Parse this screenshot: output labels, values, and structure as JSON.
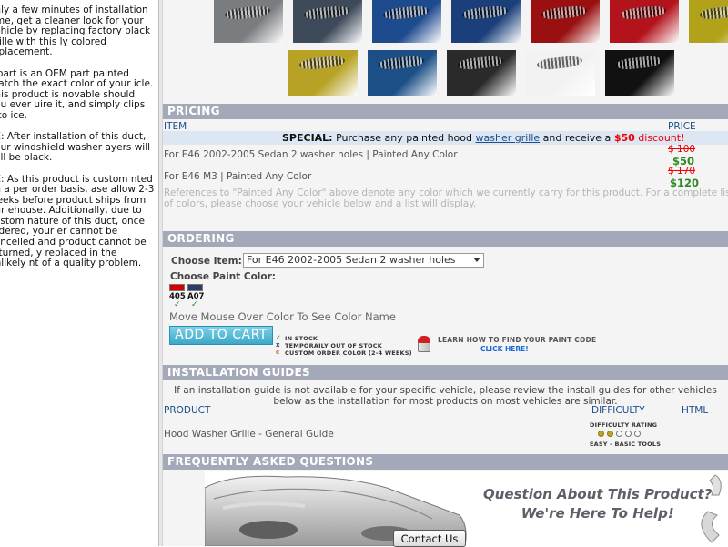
{
  "sidebar": {
    "paragraphs": [
      "only a few minutes of installation time, get a cleaner look for your vehicle by replacing factory black grille with this ly colored replacement.",
      "s part is an OEM part painted match the exact color of your icle. This product is novable should you ever uire it, and simply clips into ice.",
      "TE: After installation of this duct, your windshield washer ayers will still be black.",
      "TE: As this product is custom nted on a per order basis, ase allow 2-3 weeks before product ships from our ehouse. Additionally, due to custom nature of this duct, once ordered, your er cannot be cancelled and product cannot be returned, y replaced in the unlikely nt of a quality problem."
    ]
  },
  "thumbnails": {
    "row1": [
      "#7a7d80",
      "#3e4a5a",
      "#1e4a8e",
      "#1a3f7a",
      "#9a1010",
      "#b3141c",
      "#b2a21a"
    ],
    "row2": [
      "#b8a225",
      "#1b4f86",
      "#2a2a2a",
      "#f2f2f2",
      "#111111"
    ]
  },
  "pricing": {
    "header": "PRICING",
    "col_item": "ITEM",
    "col_price": "PRICE",
    "special_label": "SPECIAL:",
    "special_text_1": "Purchase any painted hood",
    "special_link": "washer grille",
    "special_text_2": "and receive a",
    "special_amount": "$50",
    "special_text_3": "discount!",
    "items": [
      {
        "name": "For E46 2002-2005 Sedan 2 washer holes | Painted Any Color",
        "old_price": "$ 100",
        "new_price": "$50"
      },
      {
        "name": "For E46 M3 | Painted Any Color",
        "old_price": "$ 170",
        "new_price": "$120"
      }
    ],
    "references_note": "References to \"Painted Any Color\" above denote any color which we currently carry for this product. For a complete list of colors, please choose your vehicle below and a list will display."
  },
  "ordering": {
    "header": "ORDERING",
    "choose_item_label": "Choose Item:",
    "selected_item": "For E46 2002-2005 Sedan 2 washer holes",
    "choose_paint_label": "Choose Paint Color:",
    "colors": [
      {
        "code": "405",
        "hex": "#d40000"
      },
      {
        "code": "A07",
        "hex": "#2f3d66"
      }
    ],
    "mouse_over_text": "Move Mouse Over Color To See Color Name",
    "add_to_cart": "ADD TO CART",
    "legend": {
      "in_stock": "IN STOCK",
      "out_of_stock": "TEMPORAILY OUT OF STOCK",
      "custom_order": "CUSTOM ORDER COLOR (2-4 WEEKS)"
    },
    "paint_code_text": "LEARN HOW TO FIND YOUR PAINT CODE",
    "click_here": "CLICK HERE!"
  },
  "installation": {
    "header": "INSTALLATION GUIDES",
    "note_line1": "If an installation guide is not available for your specific vehicle, please review the install guides for other vehicles",
    "note_line2": "below as the installation for most products on most vehicles are similar.",
    "col_product": "PRODUCT",
    "col_difficulty": "DIFFICULTY",
    "col_html": "HTML",
    "guide_name": "Hood Washer Grille - General Guide",
    "difficulty_label": "DIFFICULTY RATING",
    "difficulty_value": 2,
    "difficulty_max": 5,
    "difficulty_text": "EASY - BASIC TOOLS"
  },
  "faq": {
    "header": "FREQUENTLY ASKED QUESTIONS",
    "banner_line1": "Question About This Product?",
    "banner_line2": "We're Here To Help!",
    "contact_button": "Contact Us"
  }
}
